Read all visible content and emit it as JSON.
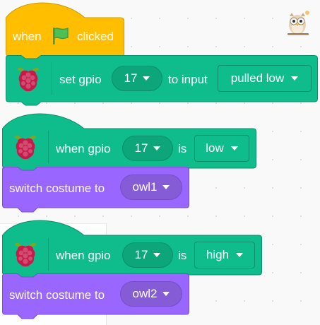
{
  "colors": {
    "events": "#ffbf00",
    "extension": "#0fbd8c",
    "looks": "#9966ff",
    "flag": "#4cbf56"
  },
  "block1": {
    "when": "when",
    "clicked": "clicked",
    "icon": "green-flag-icon"
  },
  "block2": {
    "set_gpio": "set gpio",
    "pin": "17",
    "to_input": "to input",
    "mode": "pulled low"
  },
  "block3": {
    "when_gpio": "when gpio",
    "pin": "17",
    "is": "is",
    "state": "low"
  },
  "block4": {
    "label": "switch costume to",
    "costume": "owl1"
  },
  "block5": {
    "when_gpio": "when gpio",
    "pin": "17",
    "is": "is",
    "state": "high"
  },
  "block6": {
    "label": "switch costume to",
    "costume": "owl2"
  },
  "sprite": {
    "icon": "owl-sprite-icon"
  },
  "extension": {
    "icon": "raspberry-pi-icon"
  }
}
